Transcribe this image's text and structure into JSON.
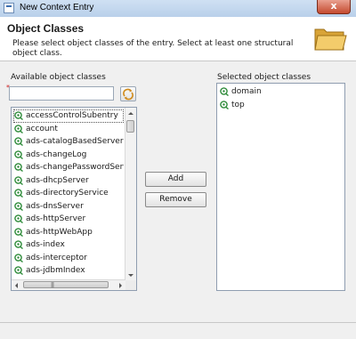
{
  "window": {
    "title": "New Context Entry",
    "close_label": "x"
  },
  "banner": {
    "heading": "Object Classes",
    "description": "Please select object classes of the entry. Select at least one structural object class.",
    "icon": "folder-icon"
  },
  "available": {
    "label": "Available object classes",
    "filter_value": "",
    "required_marker": "*",
    "refresh_icon": "refresh-icon",
    "items": [
      "accessControlSubentry",
      "account",
      "ads-catalogBasedServer",
      "ads-changeLog",
      "ads-changePasswordServer",
      "ads-dhcpServer",
      "ads-directoryService",
      "ads-dnsServer",
      "ads-httpServer",
      "ads-httpWebApp",
      "ads-index",
      "ads-interceptor",
      "ads-jdbmIndex"
    ]
  },
  "buttons": {
    "add": "Add",
    "remove": "Remove"
  },
  "selected": {
    "label": "Selected object classes",
    "items": [
      "domain",
      "top"
    ]
  },
  "colors": {
    "icon_green": "#2e8b3a",
    "title_bar": "#c3d8ef",
    "folder": "#e8b94a"
  }
}
